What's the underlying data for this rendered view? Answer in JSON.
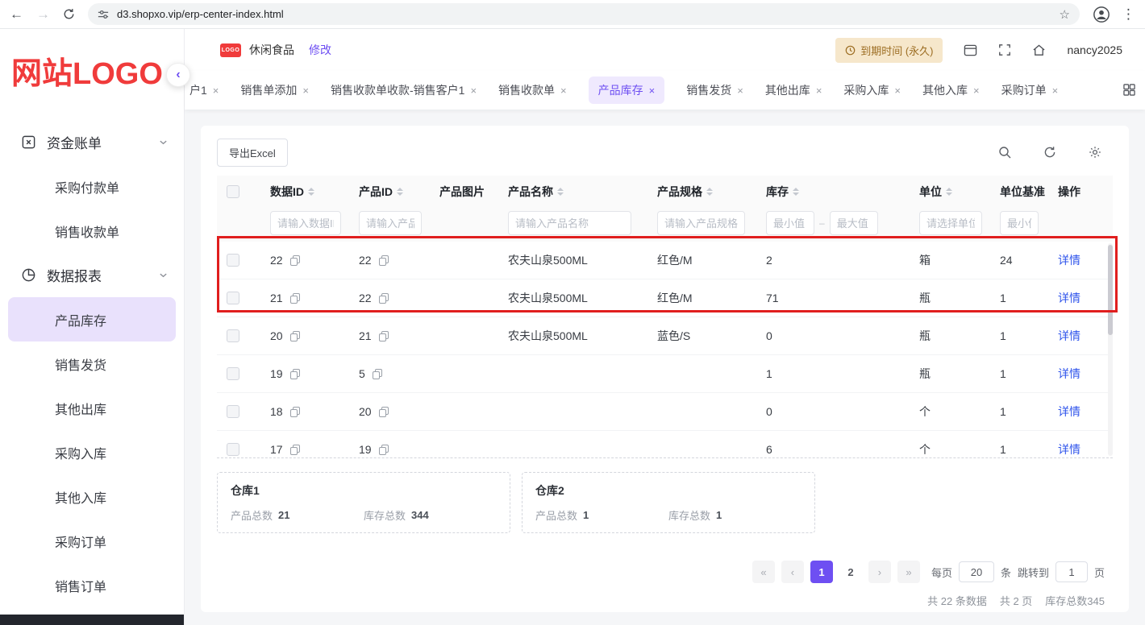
{
  "colors": {
    "accent": "#6e4ff2",
    "brand_red": "#f03b3b",
    "link_blue": "#2f54eb",
    "badge_bg": "#f6e7cb",
    "badge_text": "#9c6d22",
    "annotation": "#e01e1e"
  },
  "browser": {
    "url": "d3.shopxo.vip/erp-center-index.html"
  },
  "icons": {
    "back": "←",
    "forward": "→",
    "star": "☆",
    "menu_dots": "⋮",
    "collapse": "‹",
    "close": "×"
  },
  "sidebar": {
    "logo": "网站LOGO",
    "items": [
      {
        "label": "资金账单"
      },
      {
        "label": "采购付款单"
      },
      {
        "label": "销售收款单"
      },
      {
        "label": "数据报表"
      },
      {
        "label": "产品库存"
      },
      {
        "label": "销售发货"
      },
      {
        "label": "其他出库"
      },
      {
        "label": "采购入库"
      },
      {
        "label": "其他入库"
      },
      {
        "label": "采购订单"
      },
      {
        "label": "销售订单"
      }
    ]
  },
  "header": {
    "logo_mark": "LOGO",
    "store": "休闲食品",
    "edit": "修改",
    "expire": "到期时间 (永久)",
    "user": "nancy2025"
  },
  "tabs": [
    {
      "label": "户1"
    },
    {
      "label": "销售单添加"
    },
    {
      "label": "销售收款单收款-销售客户1"
    },
    {
      "label": "销售收款单"
    },
    {
      "label": "产品库存"
    },
    {
      "label": "销售发货"
    },
    {
      "label": "其他出库"
    },
    {
      "label": "采购入库"
    },
    {
      "label": "其他入库"
    },
    {
      "label": "采购订单"
    }
  ],
  "toolbar": {
    "export": "导出Excel"
  },
  "table": {
    "columns": [
      "数据ID",
      "产品ID",
      "产品图片",
      "产品名称",
      "产品规格",
      "库存",
      "单位",
      "单位基准",
      "操作"
    ],
    "filters": {
      "data_id": "请输入数据ID",
      "product_id": "请输入产品ID",
      "name": "请输入产品名称",
      "spec": "请输入产品规格",
      "stock_min": "最小值",
      "stock_max": "最大值",
      "unit": "请选择单位",
      "base_min": "最小值"
    },
    "range_separator": "–",
    "rows": [
      {
        "data_id": "22",
        "product_id": "22",
        "name": "农夫山泉500ML",
        "spec": "红色/M",
        "stock": "2",
        "unit": "箱",
        "base": "24",
        "action": "详情"
      },
      {
        "data_id": "21",
        "product_id": "22",
        "name": "农夫山泉500ML",
        "spec": "红色/M",
        "stock": "71",
        "unit": "瓶",
        "base": "1",
        "action": "详情"
      },
      {
        "data_id": "20",
        "product_id": "21",
        "name": "农夫山泉500ML",
        "spec": "蓝色/S",
        "stock": "0",
        "unit": "瓶",
        "base": "1",
        "action": "详情"
      },
      {
        "data_id": "19",
        "product_id": "5",
        "name": "",
        "spec": "",
        "stock": "1",
        "unit": "瓶",
        "base": "1",
        "action": "详情"
      },
      {
        "data_id": "18",
        "product_id": "20",
        "name": "",
        "spec": "",
        "stock": "0",
        "unit": "个",
        "base": "1",
        "action": "详情"
      },
      {
        "data_id": "17",
        "product_id": "19",
        "name": "",
        "spec": "",
        "stock": "6",
        "unit": "个",
        "base": "1",
        "action": "详情"
      }
    ]
  },
  "warehouses": [
    {
      "name": "仓库1",
      "product_label": "产品总数",
      "product_total": "21",
      "stock_label": "库存总数",
      "stock_total": "344"
    },
    {
      "name": "仓库2",
      "product_label": "产品总数",
      "product_total": "1",
      "stock_label": "库存总数",
      "stock_total": "1"
    }
  ],
  "pagination": {
    "first": "«",
    "prev": "‹",
    "pages": [
      "1",
      "2"
    ],
    "active_page": "1",
    "next": "›",
    "last": "»",
    "per_page_label": "每页",
    "per_page": "20",
    "unit_label": "条",
    "jump_label": "跳转到",
    "jump_value": "1",
    "page_label": "页",
    "summary": [
      "共 22 条数据",
      "共 2 页",
      "库存总数345"
    ]
  }
}
